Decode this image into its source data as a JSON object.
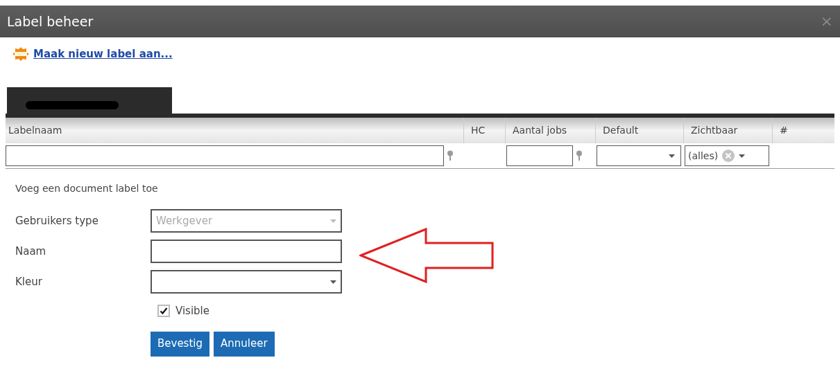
{
  "window": {
    "title": "Label beheer",
    "close": "×"
  },
  "new_label_link": "Maak nieuw label aan...",
  "tabs": [
    {
      "redacted": true,
      "selected": true
    }
  ],
  "table": {
    "columns": [
      {
        "label": "Labelnaam",
        "kind": "textfilter"
      },
      {
        "label": "HC",
        "kind": "plain"
      },
      {
        "label": "Aantal jobs",
        "kind": "textfilter"
      },
      {
        "label": "Default",
        "kind": "dropdown"
      },
      {
        "label": "Zichtbaar",
        "kind": "clearable",
        "value": "(alles)"
      },
      {
        "label": "#",
        "kind": "plain"
      }
    ]
  },
  "form": {
    "heading": "Voeg een document label toe",
    "fields": [
      {
        "label": "Gebruikers type",
        "kind": "select",
        "value": "Werkgever",
        "disabled": true
      },
      {
        "label": "Naam",
        "kind": "text"
      },
      {
        "label": "Kleur",
        "kind": "select"
      }
    ],
    "checkbox": {
      "label": "Visible",
      "checked": true
    },
    "buttons": [
      "Bevestig",
      "Annuleer"
    ]
  }
}
